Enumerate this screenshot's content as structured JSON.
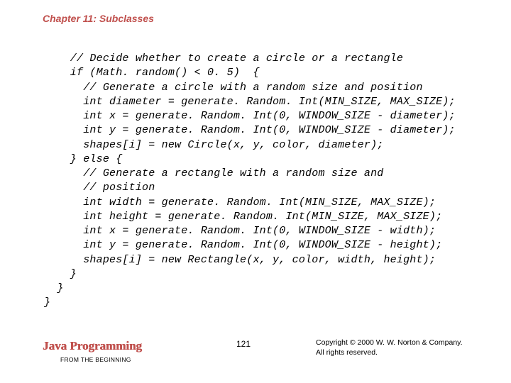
{
  "header": {
    "chapter": "Chapter 11: Subclasses"
  },
  "code": {
    "lines": [
      "    // Decide whether to create a circle or a rectangle",
      "    if (Math. random() < 0. 5)  {",
      "      // Generate a circle with a random size and position",
      "      int diameter = generate. Random. Int(MIN_SIZE, MAX_SIZE);",
      "      int x = generate. Random. Int(0, WINDOW_SIZE - diameter);",
      "      int y = generate. Random. Int(0, WINDOW_SIZE - diameter);",
      "      shapes[i] = new Circle(x, y, color, diameter);",
      "    } else {",
      "      // Generate a rectangle with a random size and",
      "      // position",
      "      int width = generate. Random. Int(MIN_SIZE, MAX_SIZE);",
      "      int height = generate. Random. Int(MIN_SIZE, MAX_SIZE);",
      "      int x = generate. Random. Int(0, WINDOW_SIZE - width);",
      "      int y = generate. Random. Int(0, WINDOW_SIZE - height);",
      "      shapes[i] = new Rectangle(x, y, color, width, height);",
      "    }",
      "  }",
      "}"
    ]
  },
  "footer": {
    "book_title": "Java Programming",
    "book_subtitle": "FROM THE BEGINNING",
    "page_number": "121",
    "copyright_line1": "Copyright © 2000 W. W. Norton & Company.",
    "copyright_line2": "All rights reserved."
  }
}
